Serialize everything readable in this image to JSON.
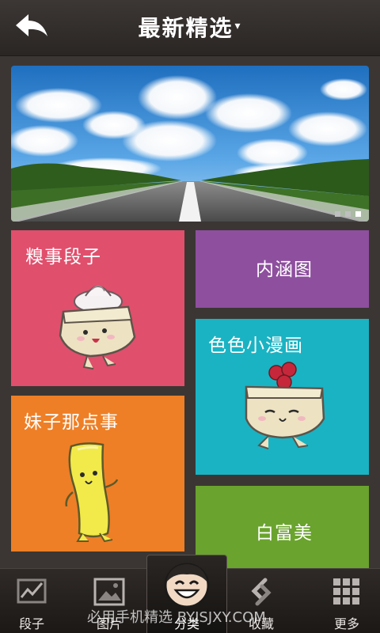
{
  "header": {
    "title": "最新精选",
    "dropdown_glyph": "▾",
    "back_icon": "back-arrow-icon"
  },
  "banner": {
    "image": "highway-sky-landscape",
    "slide_count": 3,
    "active_slide": 3
  },
  "tiles": [
    {
      "label": "糗事段子",
      "color": "#e04f6c"
    },
    {
      "label": "内涵图",
      "color": "#8e4f9f"
    },
    {
      "label": "色色小漫画",
      "color": "#1ab3c3"
    },
    {
      "label": "妹子那点事",
      "color": "#ee7f26"
    },
    {
      "label": "白富美",
      "color": "#6aa32d"
    }
  ],
  "bottom_nav": {
    "items": [
      {
        "label": "段子",
        "icon": "chart-line-icon"
      },
      {
        "label": "图片",
        "icon": "image-icon"
      },
      {
        "label": "分类",
        "icon": "smiley-face-icon",
        "active": true
      },
      {
        "label": "收藏",
        "icon": "shazam-s-icon"
      },
      {
        "label": "更多",
        "icon": "grid-icon"
      }
    ]
  },
  "watermark": "必用手机精选 BYJSJXY.COM"
}
